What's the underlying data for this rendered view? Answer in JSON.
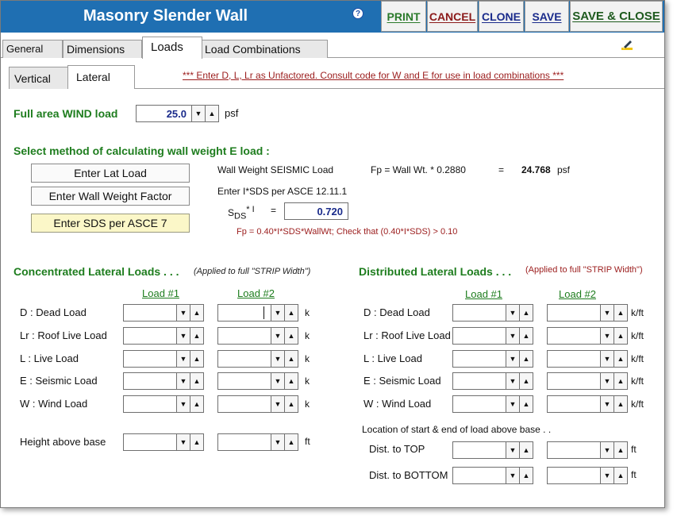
{
  "window": {
    "title": "Masonry Slender Wall",
    "help_icon": "?"
  },
  "toolbar": {
    "print": "PRINT",
    "cancel": "CANCEL",
    "clone": "CLONE",
    "save": "SAVE",
    "save_close": "SAVE & CLOSE"
  },
  "tabs": [
    {
      "label": "General"
    },
    {
      "label": "Dimensions"
    },
    {
      "label": "Loads"
    },
    {
      "label": "Load Combinations"
    }
  ],
  "subtabs": [
    {
      "label": "Vertical"
    },
    {
      "label": "Lateral"
    }
  ],
  "notice": "*** Enter D, L, Lr as Unfactored. Consult code for W and E for use in load combinations  ***",
  "wind": {
    "label": "Full area WIND load",
    "value": "25.0",
    "unit": "psf"
  },
  "method": {
    "heading": "Select method of calculating wall weight E load :",
    "buttons": [
      "Enter Lat Load",
      "Enter Wall Weight Factor",
      "Enter SDS per ASCE 7"
    ],
    "seismic_label": "Wall Weight SEISMIC Load",
    "formula": "Fp = Wall Wt. * 0.2880",
    "equals": "=",
    "result_value": "24.768",
    "result_unit": "psf",
    "enter_label": "Enter I*SDS per ASCE 12.11.1",
    "sds_s": "S",
    "sds_sub": "DS",
    "sds_rest": "* I",
    "sds_eq": "=",
    "sds_value": "0.720",
    "check_note": "Fp = 0.40*I*SDS*WallWt; Check that (0.40*I*SDS) > 0.10"
  },
  "concentrated": {
    "heading": "Concentrated Lateral Loads . . .",
    "note": "(Applied to full \"STRIP Width\")",
    "col1": "Load #1",
    "col2": "Load #2",
    "rows": [
      {
        "label": "D : Dead Load",
        "unit": "k"
      },
      {
        "label": "Lr : Roof Live Load",
        "unit": "k"
      },
      {
        "label": "L : Live Load",
        "unit": "k"
      },
      {
        "label": "E : Seismic Load",
        "unit": "k"
      },
      {
        "label": "W : Wind Load",
        "unit": "k"
      }
    ],
    "height_label": "Height above base",
    "height_unit": "ft"
  },
  "distributed": {
    "heading": "Distributed Lateral Loads . . .",
    "note": "(Applied to full \"STRIP Width\")",
    "col1": "Load #1",
    "col2": "Load #2",
    "rows": [
      {
        "label": "D : Dead Load",
        "unit": "k/ft"
      },
      {
        "label": "Lr : Roof Live Load",
        "unit": "k/ft"
      },
      {
        "label": "L : Live Load",
        "unit": "k/ft"
      },
      {
        "label": "E : Seismic Load",
        "unit": "k/ft"
      },
      {
        "label": "W : Wind Load",
        "unit": "k/ft"
      }
    ],
    "location_label": "Location of start & end of load above base . .",
    "top_label": "Dist. to TOP",
    "top_unit": "ft",
    "bottom_label": "Dist. to BOTTOM",
    "bottom_unit": "ft"
  },
  "arrows": {
    "down": "▼",
    "up": "▲"
  }
}
